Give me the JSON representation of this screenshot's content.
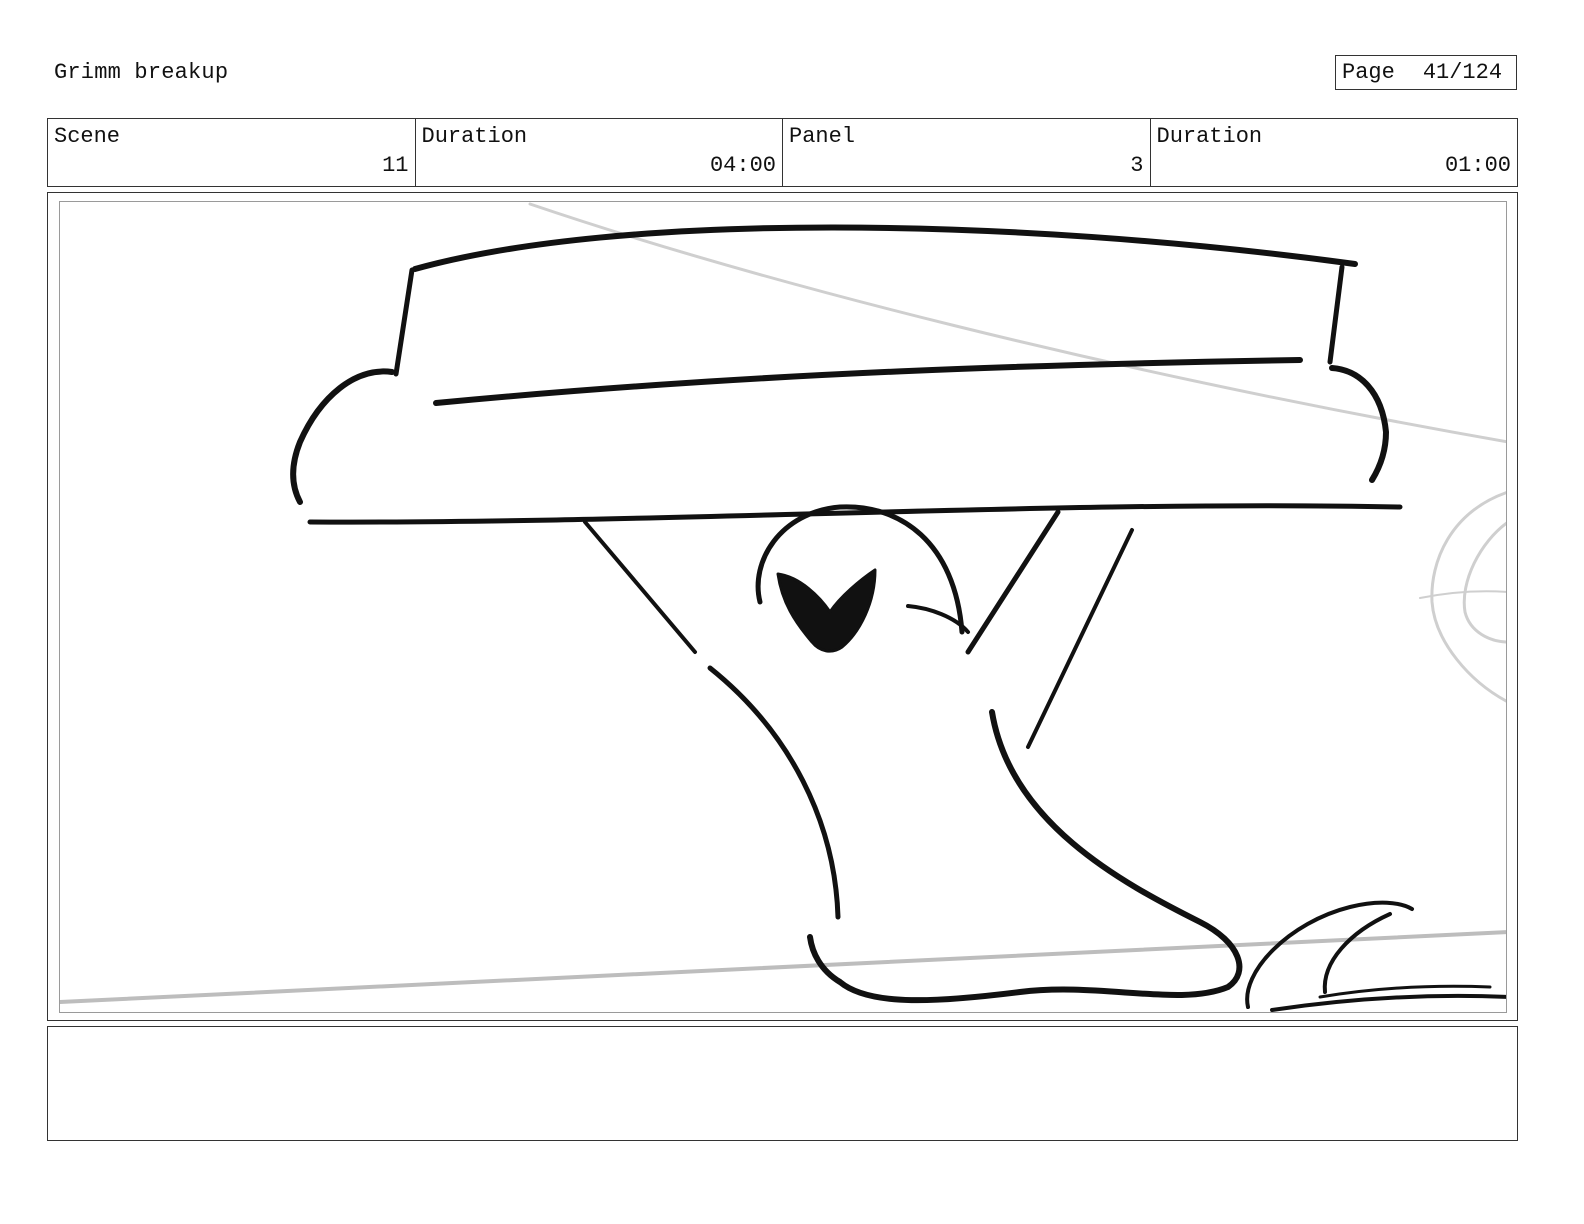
{
  "header": {
    "title": "Grimm breakup",
    "page_label": "Page",
    "page_value": "41/124"
  },
  "info": {
    "scene_label": "Scene",
    "scene_value": "11",
    "scene_duration_label": "Duration",
    "scene_duration_value": "04:00",
    "panel_label": "Panel",
    "panel_value": "3",
    "panel_duration_label": "Duration",
    "panel_duration_value": "01:00"
  },
  "notes": {
    "text": ""
  },
  "colors": {
    "ink": "#111111",
    "guide": "#c8c8c8",
    "frame": "#333333"
  }
}
